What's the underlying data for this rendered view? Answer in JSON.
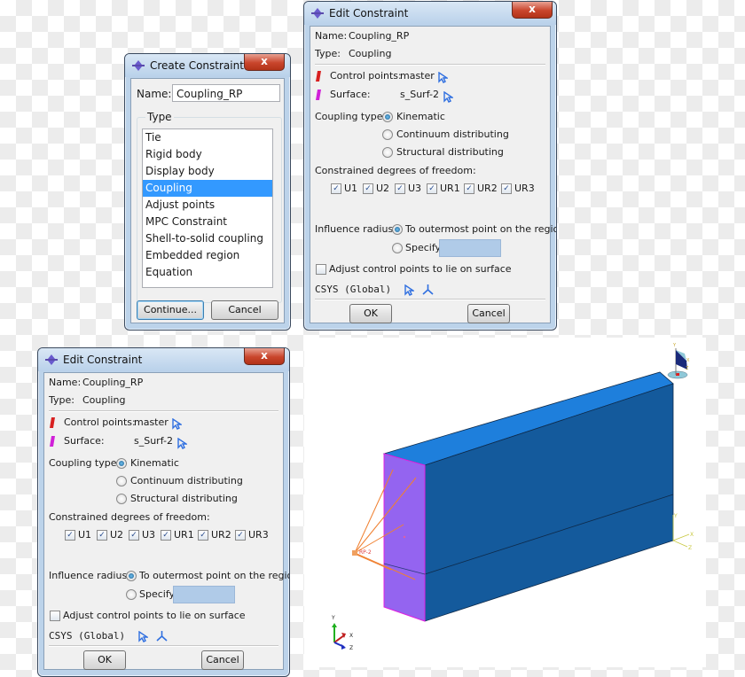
{
  "create_dialog": {
    "title": "Create Constraint",
    "close_label": "x",
    "name_label": "Name:",
    "name_value": "Coupling_RP",
    "type_group_label": "Type",
    "types": [
      "Tie",
      "Rigid body",
      "Display body",
      "Coupling",
      "Adjust points",
      "MPC Constraint",
      "Shell-to-solid coupling",
      "Embedded region",
      "Equation"
    ],
    "selected_type": "Coupling",
    "continue_label": "Continue...",
    "cancel_label": "Cancel"
  },
  "edit_dialog": {
    "title": "Edit Constraint",
    "close_label": "x",
    "name_label": "Name:",
    "name_value": "Coupling_RP",
    "type_label": "Type:",
    "type_value": "Coupling",
    "control_points_label": "Control points:",
    "control_points_value": "master",
    "surface_label": "Surface:",
    "surface_value": "s_Surf-2",
    "coupling_type_label": "Coupling type:",
    "coupling_types": [
      "Kinematic",
      "Continuum distributing",
      "Structural distributing"
    ],
    "selected_coupling_type": "Kinematic",
    "dof_label": "Constrained degrees of freedom:",
    "dofs": [
      {
        "label": "U1",
        "checked": true
      },
      {
        "label": "U2",
        "checked": true
      },
      {
        "label": "U3",
        "checked": true
      },
      {
        "label": "UR1",
        "checked": true
      },
      {
        "label": "UR2",
        "checked": true
      },
      {
        "label": "UR3",
        "checked": true
      }
    ],
    "influence_label": "Influence radius:",
    "influence_options": [
      "To outermost point on the region",
      "Specify:"
    ],
    "selected_influence": "To outermost point on the region",
    "specify_value": "",
    "adjust_label": "Adjust control points to lie on surface",
    "adjust_checked": false,
    "csys_label": "CSYS (Global)",
    "ok_label": "OK",
    "cancel_label": "Cancel",
    "check_glyph": "✓"
  },
  "viewport": {
    "rp_label": "RP-2",
    "triad_labels": {
      "y": "Y",
      "x": "X",
      "z": "Z"
    },
    "colors": {
      "top_face": "#1e7fdc",
      "front_face": "#145a9c",
      "surface_face": "#9464f0",
      "surface_edge": "#e020e0",
      "coupling_lines": "#f08030",
      "local_csys": "#c8c840"
    }
  }
}
